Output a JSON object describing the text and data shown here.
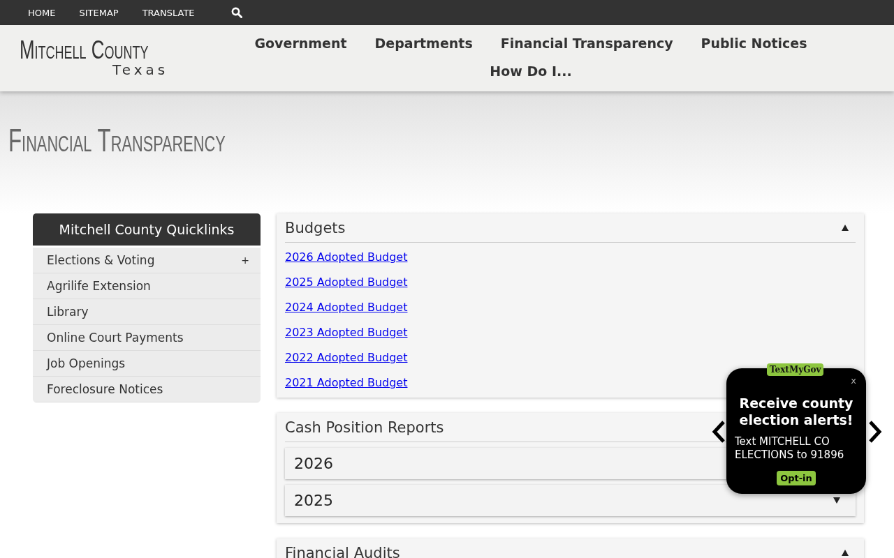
{
  "top_bar": {
    "links": [
      "HOME",
      "SITEMAP",
      "TRANSLATE"
    ]
  },
  "header": {
    "logo": {
      "name": "Mitchell County",
      "state": "Texas"
    },
    "nav": [
      "Government",
      "Departments",
      "Financial Transparency",
      "Public Notices",
      "How Do I..."
    ]
  },
  "page_title": "Financial Transparency",
  "sidebar": {
    "title": "Mitchell County Quicklinks",
    "items": [
      {
        "label": "Elections & Voting",
        "toggle": "+"
      },
      {
        "label": "Agrilife Extension"
      },
      {
        "label": "Library"
      },
      {
        "label": "Online Court Payments"
      },
      {
        "label": "Job Openings"
      },
      {
        "label": "Foreclosure Notices"
      }
    ]
  },
  "sections": [
    {
      "title": "Budgets",
      "expanded": true,
      "links": [
        "2026 Adopted Budget",
        "2025 Adopted Budget",
        "2024 Adopted Budget",
        "2023 Adopted Budget",
        "2022 Adopted Budget",
        "2021 Adopted Budget"
      ]
    },
    {
      "title": "Cash Position Reports",
      "expanded": true,
      "subsections": [
        {
          "title": "2026"
        },
        {
          "title": "2025",
          "expanded": false
        }
      ]
    },
    {
      "title": "Financial Audits",
      "expanded": true
    }
  ],
  "popup": {
    "brand": "TextMyGov",
    "close": "x",
    "heading": "Receive county election alerts!",
    "message": "Text MITCHELL CO ELECTIONS to 91896",
    "button": "Opt-in"
  }
}
